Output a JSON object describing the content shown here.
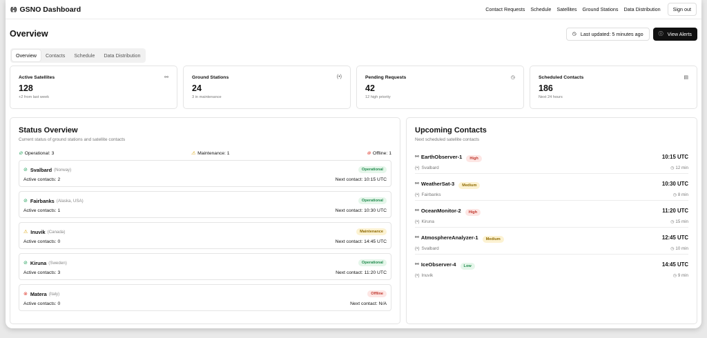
{
  "app": {
    "title": "GSNO Dashboard"
  },
  "nav": {
    "items": [
      "Contact Requests",
      "Schedule",
      "Satellites",
      "Ground Stations",
      "Data Distribution"
    ],
    "signout": "Sign out"
  },
  "header": {
    "title": "Overview",
    "last_updated": "Last updated: 5 minutes ago",
    "alerts": "View Alerts"
  },
  "tabs": [
    "Overview",
    "Contacts",
    "Schedule",
    "Data Distribution"
  ],
  "stats": [
    {
      "title": "Active Satellites",
      "value": "128",
      "sub": "+2 from last week",
      "icon": "satellite-icon"
    },
    {
      "title": "Ground Stations",
      "value": "24",
      "sub": "3 in maintenance",
      "icon": "antenna-icon"
    },
    {
      "title": "Pending Requests",
      "value": "42",
      "sub": "12 high priority",
      "icon": "clock-icon"
    },
    {
      "title": "Scheduled Contacts",
      "value": "186",
      "sub": "Next 24 hours",
      "icon": "calendar-icon"
    }
  ],
  "status": {
    "title": "Status Overview",
    "subtitle": "Current status of ground stations and satellite contacts",
    "operational": "Operational: 3",
    "maintenance": "Maintenance: 1",
    "offline": "Offline: 1",
    "stations": [
      {
        "name": "Svalbard",
        "location": "(Norway)",
        "status": "Operational",
        "kind": "op",
        "active": "Active contacts: 2",
        "next": "Next contact: 10:15 UTC"
      },
      {
        "name": "Fairbanks",
        "location": "(Alaska, USA)",
        "status": "Operational",
        "kind": "op",
        "active": "Active contacts: 1",
        "next": "Next contact: 10:30 UTC"
      },
      {
        "name": "Inuvik",
        "location": "(Canada)",
        "status": "Maintenance",
        "kind": "mt",
        "active": "Active contacts: 0",
        "next": "Next contact: 14:45 UTC"
      },
      {
        "name": "Kiruna",
        "location": "(Sweden)",
        "status": "Operational",
        "kind": "op",
        "active": "Active contacts: 3",
        "next": "Next contact: 11:20 UTC"
      },
      {
        "name": "Matera",
        "location": "(Italy)",
        "status": "Offline",
        "kind": "off",
        "active": "Active contacts: 0",
        "next": "Next contact: N/A"
      }
    ]
  },
  "upcoming": {
    "title": "Upcoming Contacts",
    "subtitle": "Next scheduled satellite contacts",
    "contacts": [
      {
        "satellite": "EarthObserver-1",
        "priority": "High",
        "kind": "high",
        "station": "Svalbard",
        "time": "10:15 UTC",
        "in": "12 min"
      },
      {
        "satellite": "WeatherSat-3",
        "priority": "Medium",
        "kind": "med",
        "station": "Fairbanks",
        "time": "10:30 UTC",
        "in": "8 min"
      },
      {
        "satellite": "OceanMonitor-2",
        "priority": "High",
        "kind": "high",
        "station": "Kiruna",
        "time": "11:20 UTC",
        "in": "15 min"
      },
      {
        "satellite": "AtmosphereAnalyzer-1",
        "priority": "Medium",
        "kind": "med",
        "station": "Svalbard",
        "time": "12:45 UTC",
        "in": "10 min"
      },
      {
        "satellite": "IceObserver-4",
        "priority": "Low",
        "kind": "low",
        "station": "Inuvik",
        "time": "14:45 UTC",
        "in": "9 min"
      }
    ]
  }
}
